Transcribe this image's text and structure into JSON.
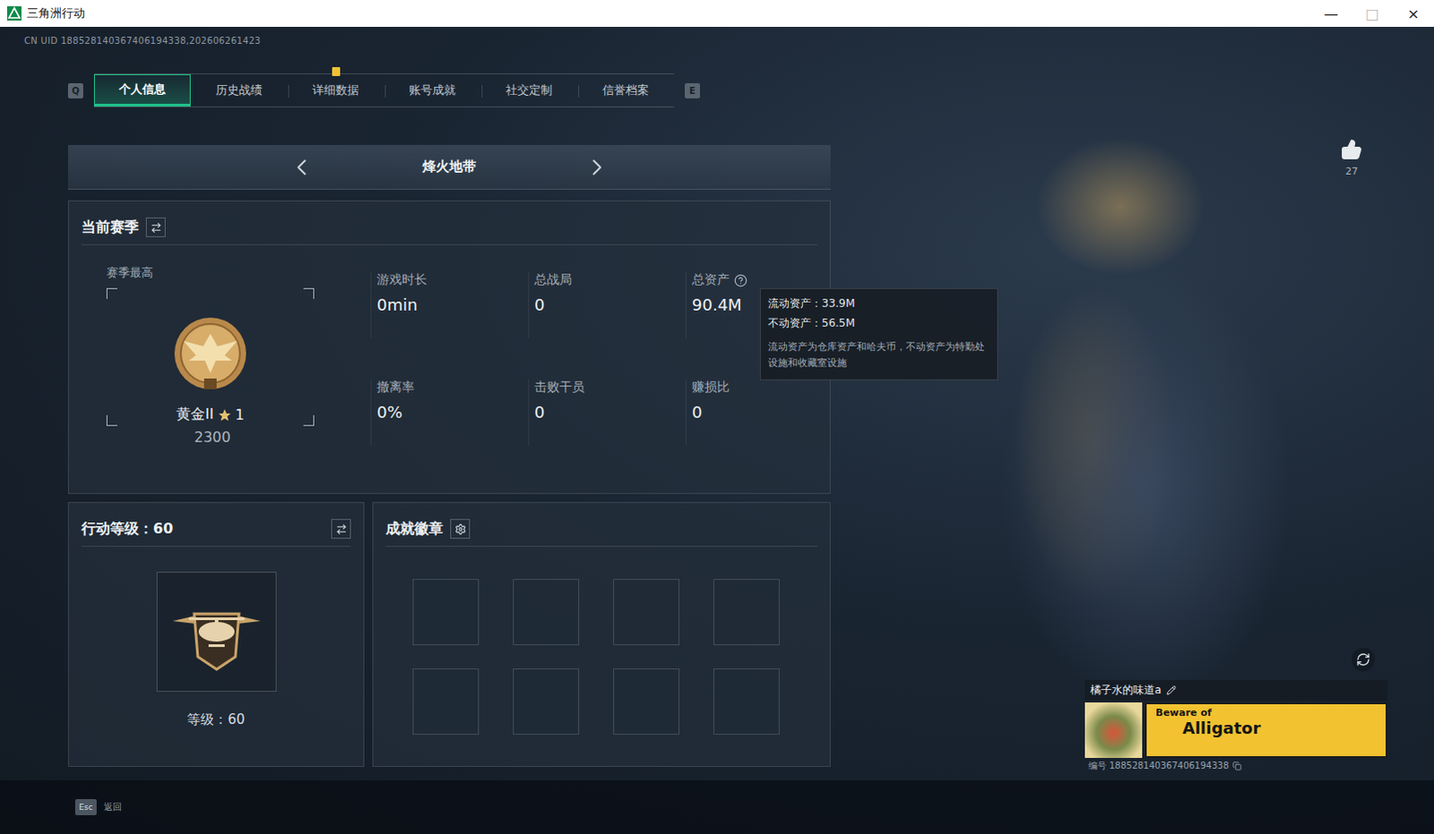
{
  "window": {
    "title": "三角洲行动",
    "controls": [
      {
        "glyph": "—",
        "disabled": false
      },
      {
        "glyph": "□",
        "disabled": true
      },
      {
        "glyph": "×",
        "disabled": false
      }
    ]
  },
  "uid": "CN UID 188528140367406194338,202606261423",
  "tabs": {
    "prev_key": "Q",
    "next_key": "E",
    "items": [
      {
        "label": "个人信息",
        "selected": true,
        "alert": false
      },
      {
        "label": "历史战绩",
        "selected": false,
        "alert": false
      },
      {
        "label": "详细数据",
        "selected": false,
        "alert": true
      },
      {
        "label": "账号成就",
        "selected": false,
        "alert": false
      },
      {
        "label": "社交定制",
        "selected": false,
        "alert": false
      },
      {
        "label": "信誉档案",
        "selected": false,
        "alert": false
      }
    ]
  },
  "mode": {
    "label": "烽火地带"
  },
  "season": {
    "title": "当前赛季",
    "best_label": "赛季最高",
    "rank": "黄金II",
    "stars": 1,
    "star_count": "1",
    "score": "2300",
    "stats": [
      {
        "label": "游戏时长",
        "value": "0min",
        "help": false
      },
      {
        "label": "总战局",
        "value": "0",
        "help": false
      },
      {
        "label": "总资产",
        "value": "90.4M",
        "help": true
      },
      {
        "label": "撤离率",
        "value": "0%",
        "help": false
      },
      {
        "label": "击败干员",
        "value": "0",
        "help": false
      },
      {
        "label": "赚损比",
        "value": "0",
        "help": false
      }
    ]
  },
  "tooltip": {
    "lines": [
      "流动资产：33.9M",
      "不动资产：56.5M"
    ],
    "note": "流动资产为仓库资产和哈夫币，不动资产为特勤处设施和收藏室设施"
  },
  "level": {
    "title": "行动等级：60",
    "caption": "等级：60"
  },
  "badges": {
    "title": "成就徽章",
    "slots": [
      {
        "filled": false
      },
      {
        "filled": false
      },
      {
        "filled": false
      },
      {
        "filled": false
      },
      {
        "filled": false
      },
      {
        "filled": false
      },
      {
        "filled": false
      },
      {
        "filled": false
      }
    ]
  },
  "likes": "27",
  "profile": {
    "name": "橘子水的味道a",
    "banner": [
      "Beware of",
      "Alligator"
    ],
    "id": "编号 188528140367406194338"
  },
  "footer": {
    "key": "Esc",
    "label": "返回"
  }
}
